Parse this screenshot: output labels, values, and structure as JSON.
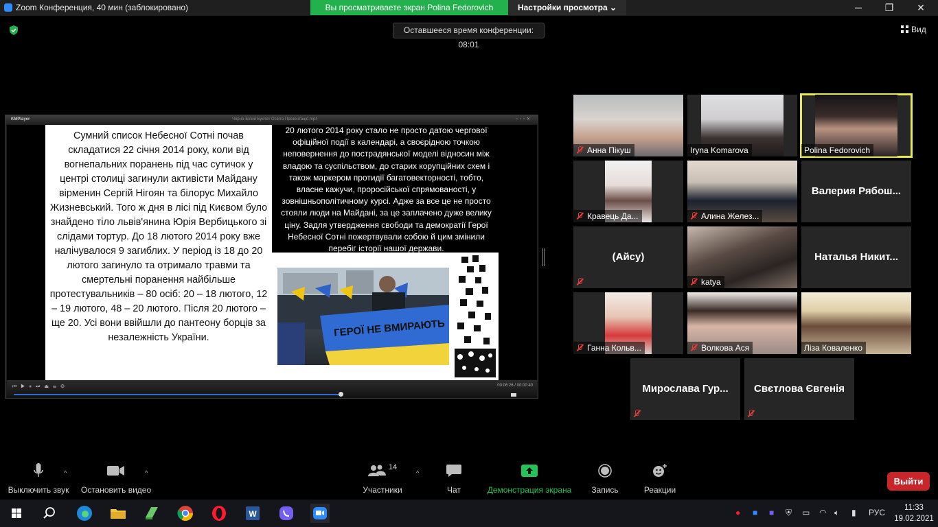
{
  "window": {
    "title": "Zoom Конференция, 40 мин  (заблокировано)",
    "share_banner": "Вы просматриваете экран Polina Fedorovich",
    "view_options": "Настройки просмотра ⌄",
    "controls": [
      "─",
      "❐",
      "✕"
    ]
  },
  "meeting": {
    "timer": "Оставшееся время конференции: 08:01",
    "view_label": "Вид"
  },
  "shared_screen": {
    "player_name": "KMPlayer",
    "file_title": "Чорно-Білий Буклет Освіта Презентація.mp4",
    "slide_left_text": "Сумний список Небесної Сотні почав складатися 22 січня 2014 року, коли від вогнепальних поранень під час сутичок у центрі столиці загинули активісти Майдану вірменин Сергій Нігоян та білорус Михайло Жизневський. Того ж дня в лісі під Києвом було знайдено тіло львів'янина Юрія Вербицького зі слідами тортур. До 18 лютого 2014 року вже налічувалося 9 загиблих. У період із 18 до 20 лютого загинуло та отримало травми та смертельні поранення найбільше протестувальників – 80 осіб: 20 – 18 лютого, 12 – 19 лютого, 48 – 20 лютого. Після 20 лютого – ще 20. Усі вони ввійшли до пантеону борців за незалежність України.",
    "slide_right_text": "20 лютого 2014 року стало не просто датою чергової офіційної події в календарі, а своєрідною точкою неповернення до пострадянської моделі відносин між владою та суспільством, до старих корупційних схем і також маркером протидії багатовекторності, тобто, власне кажучи, проросійської спрямованості, у зовнішньополітичному курсі. Адже за все це не просто стояли люди на Майдані, за це заплачено дуже велику ціну. Задля утвердження свободи та демократії Герої Небесної Сотні пожертвували собою й цим змінили перебіг історії нашої держави.",
    "banner_text": "ГЕРОЇ НЕ ВМИРАЮТЬ",
    "time_readout": "00:06:26 / 00:00:40",
    "seek_progress": 0.63
  },
  "participants": [
    {
      "name": "Анна Пікуш",
      "muted": true,
      "video": true,
      "active": false
    },
    {
      "name": "Iryna Komarova",
      "muted": false,
      "video": true,
      "active": false
    },
    {
      "name": "Polina Fedorovich",
      "muted": false,
      "video": true,
      "active": true
    },
    {
      "name": "Кравець Да...",
      "muted": true,
      "video": true,
      "active": false
    },
    {
      "name": "Алина Желез...",
      "muted": true,
      "video": true,
      "active": false
    },
    {
      "name": "Валерия  Рябош...",
      "muted": false,
      "video": false,
      "active": false
    },
    {
      "name": "(Айсу)",
      "muted": true,
      "video": false,
      "active": false
    },
    {
      "name": "katya",
      "muted": true,
      "video": true,
      "active": false
    },
    {
      "name": "Наталья  Никит...",
      "muted": false,
      "video": false,
      "active": false
    },
    {
      "name": "Ганна Кольв...",
      "muted": true,
      "video": true,
      "active": false
    },
    {
      "name": "Волкова Ася",
      "muted": true,
      "video": true,
      "active": false
    },
    {
      "name": "Ліза Коваленко",
      "muted": false,
      "video": true,
      "active": false
    },
    {
      "name": "Мирослава  Гур...",
      "muted": true,
      "video": false,
      "active": false
    },
    {
      "name": "Свєтлова Євгенія",
      "muted": true,
      "video": false,
      "active": false
    }
  ],
  "toolbar": {
    "mute": "Выключить звук",
    "video": "Остановить видео",
    "participants": "Участники",
    "participants_count": "14",
    "chat": "Чат",
    "share": "Демонстрация экрана",
    "record": "Запись",
    "reactions": "Реакции",
    "leave": "Выйти"
  },
  "taskbar": {
    "lang": "РУС",
    "time": "11:33",
    "date": "19.02.2021"
  },
  "colors": {
    "share_green": "#23b14d",
    "leave_red": "#c8262b",
    "active_speaker": "#e6e85a",
    "muted_red": "#e23c3c"
  }
}
